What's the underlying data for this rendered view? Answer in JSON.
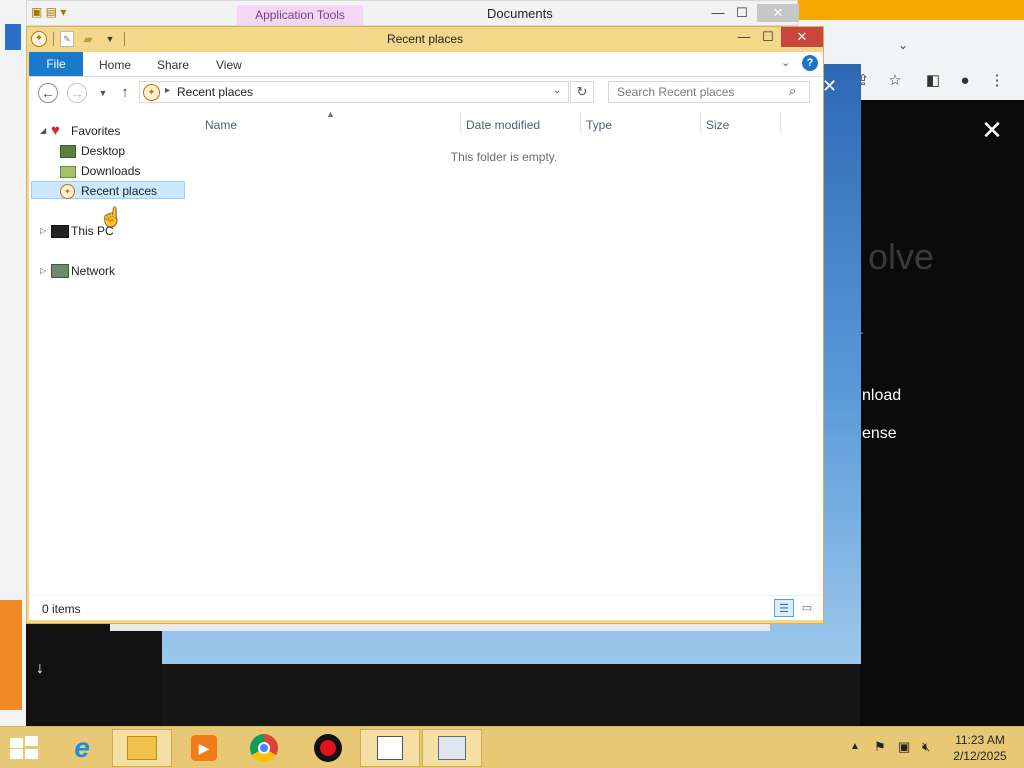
{
  "back_window": {
    "title": "Documents",
    "app_tools": "Application Tools"
  },
  "window": {
    "title": "Recent places",
    "controls": {
      "minimize": "—",
      "maximize": "☐",
      "close": "✕"
    }
  },
  "ribbon": {
    "tabs": [
      "File",
      "Home",
      "Share",
      "View"
    ],
    "help": "?"
  },
  "navbar": {
    "address": "Recent places",
    "search_placeholder": "Search Recent places"
  },
  "nav_pane": {
    "favorites": "Favorites",
    "items": [
      "Desktop",
      "Downloads",
      "Recent places"
    ],
    "this_pc": "This PC",
    "network": "Network"
  },
  "file_list": {
    "columns": [
      "Name",
      "Date modified",
      "Type",
      "Size"
    ],
    "empty_message": "This folder is empty."
  },
  "status": {
    "item_count": "0 items"
  },
  "browser": {
    "promo_fragment": "olve",
    "download_fragment": "nload",
    "license_fragment": "ense"
  },
  "taskbar": {
    "time": "11:23 AM",
    "date": "2/12/2025"
  },
  "colors": {
    "explorer_frame": "#f3d78b",
    "file_tab": "#1979ca",
    "close_button": "#c9463d",
    "selection": "#cce8ff",
    "taskbar": "#e8c874"
  }
}
